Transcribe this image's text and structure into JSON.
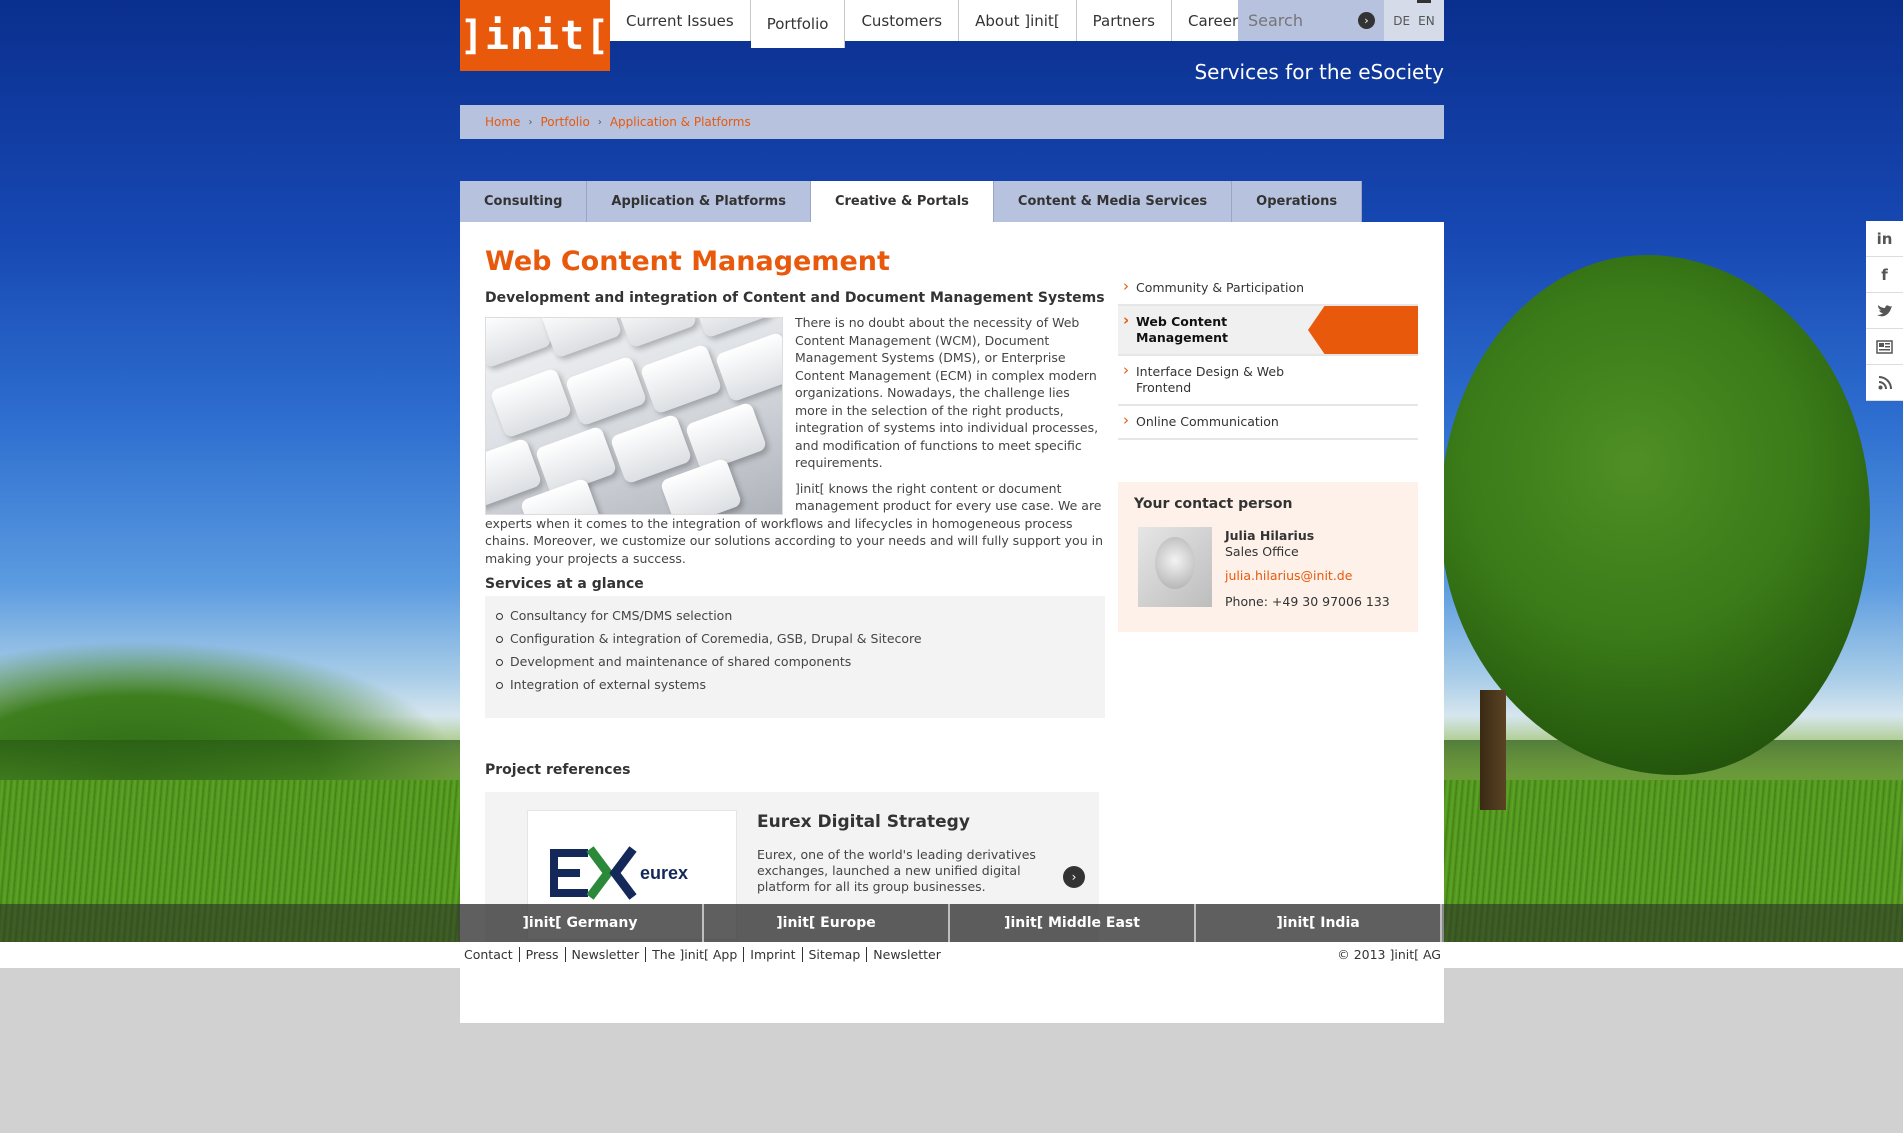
{
  "logo": "]init[",
  "topnav": [
    "Current Issues",
    "Portfolio",
    "Customers",
    "About ]init[",
    "Partners",
    "Career"
  ],
  "search": {
    "placeholder": "Search"
  },
  "languages": [
    "DE",
    "EN"
  ],
  "tagline": "Services for the eSociety",
  "breadcrumb": [
    "Home",
    "Portfolio",
    "Application & Platforms"
  ],
  "tabs": [
    "Consulting",
    "Application & Platforms",
    "Creative & Portals",
    "Content & Media Services",
    "Operations"
  ],
  "main": {
    "title": "Web Content Management",
    "subtitle": "Development and integration of Content and Document Management Systems",
    "paragraph1": "There is no doubt about the necessity of Web Content Management (WCM), Document Management Systems (DMS), or Enterprise Content Management (ECM) in complex modern organizations. Nowadays, the challenge lies more in the selection of the right products, integration of systems into individual processes, and modification of functions to meet specific requirements.",
    "paragraph2": "]init[ knows the right content or document management product for every use case. We are experts when it comes to the integration of workflows and lifecycles in homogeneous process chains. Moreover, we customize our solutions according to your needs and will fully support you in making your projects a success.",
    "services_heading": "Services at a glance",
    "services": [
      "Consultancy for CMS/DMS selection",
      "Configuration & integration of Coremedia, GSB, Drupal & Sitecore",
      "Development and maintenance of shared components",
      "Integration of external systems"
    ],
    "references_heading": "Project references",
    "reference": {
      "logo_text": "eurex",
      "title": "Eurex Digital Strategy",
      "text": "Eurex, one of the world's leading derivatives exchanges, launched a new unified digital platform for all its group businesses."
    }
  },
  "sidenav": [
    "Community & Participation",
    "Web Content Management",
    "Interface Design & Web Frontend",
    "Online Communication"
  ],
  "contact": {
    "heading": "Your contact person",
    "name": "Julia Hilarius",
    "role": "Sales Office",
    "email": "julia.hilarius@init.de",
    "phone": "Phone: +49 30 97006 133"
  },
  "social": [
    "linkedin-icon",
    "facebook-icon",
    "twitter-icon",
    "news-icon",
    "rss-icon"
  ],
  "offices": [
    "]init[ Germany",
    "]init[ Europe",
    "]init[ Middle East",
    "]init[ India"
  ],
  "footer": {
    "links": [
      "Contact",
      "Press",
      "Newsletter",
      "The ]init[ App",
      "Imprint",
      "Sitemap",
      "Newsletter"
    ],
    "copyright": "© 2013 ]init[ AG"
  },
  "colors": {
    "brand_orange": "#e8590c",
    "nav_blue": "#b7c2de"
  }
}
